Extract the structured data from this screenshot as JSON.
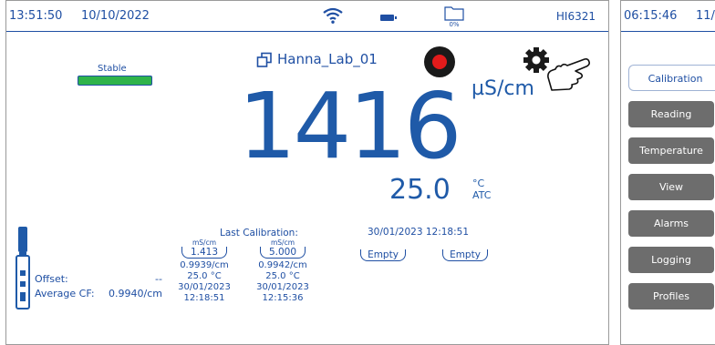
{
  "status_bar": {
    "time": "13:51:50",
    "date": "10/10/2022",
    "model": "HI6321",
    "storage_percent": "0%"
  },
  "stability": {
    "label": "Stable",
    "color": "#2fb34a"
  },
  "profile": {
    "name": "Hanna_Lab_01"
  },
  "measurement": {
    "value": "1416",
    "unit": "µS/cm",
    "temperature": "25.0",
    "temperature_unit": "°C",
    "temperature_mode": "ATC"
  },
  "probe_info": {
    "offset_label": "Offset:",
    "offset_value": "--",
    "cf_label": "Average CF:",
    "cf_value": "0.9940/cm"
  },
  "last_calibration": {
    "title": "Last Calibration:",
    "date": "30/01/2023  12:18:51",
    "points": [
      {
        "unit": "mS/cm",
        "standard": "1.413",
        "cell_constant": "0.9939/cm",
        "temp": "25.0 °C",
        "date": "30/01/2023",
        "time": "12:18:51"
      },
      {
        "unit": "mS/cm",
        "standard": "5.000",
        "cell_constant": "0.9942/cm",
        "temp": "25.0 °C",
        "date": "30/01/2023",
        "time": "12:15:36"
      }
    ],
    "empty_slots": [
      "Empty",
      "Empty"
    ]
  },
  "second_screen": {
    "status_bar": {
      "time": "06:15:46",
      "date": "11/"
    },
    "menu": [
      {
        "label": "Calibration",
        "active": true
      },
      {
        "label": "Reading",
        "active": false
      },
      {
        "label": "Temperature",
        "active": false
      },
      {
        "label": "View",
        "active": false
      },
      {
        "label": "Alarms",
        "active": false
      },
      {
        "label": "Logging",
        "active": false
      },
      {
        "label": "Profiles",
        "active": false
      }
    ]
  },
  "colors": {
    "primary": "#1f4fa3",
    "record": "#e21b1b",
    "tab": "#6d6d6d"
  }
}
